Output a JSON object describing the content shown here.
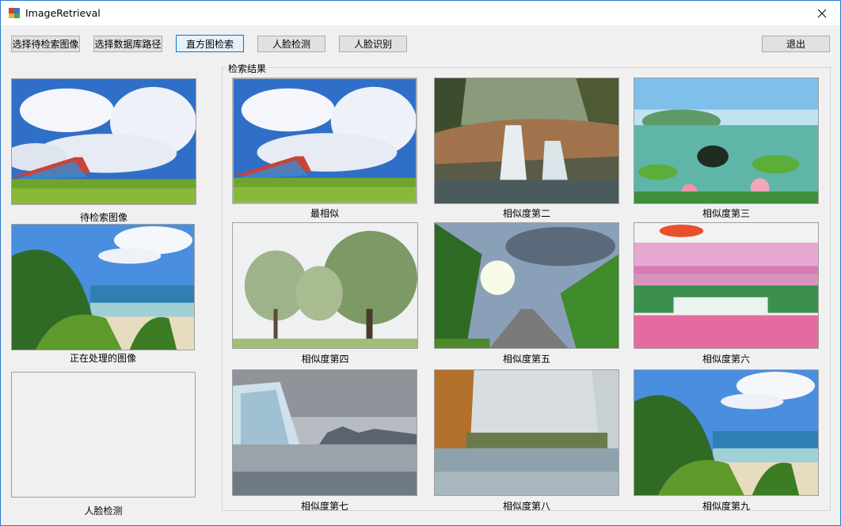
{
  "window": {
    "title": "ImageRetrieval"
  },
  "toolbar": {
    "select_query": "选择待检索图像",
    "select_db": "选择数据库路径",
    "hist_search": "直方图检索",
    "face_detect": "人脸检测",
    "face_recog": "人脸识别",
    "exit": "退出"
  },
  "left": {
    "query_caption": "待检索图像",
    "processing_caption": "正在处理的图像",
    "face_caption": "人脸检测"
  },
  "results": {
    "group_title": "检索结果",
    "items": [
      {
        "caption": "最相似"
      },
      {
        "caption": "相似度第二"
      },
      {
        "caption": "相似度第三"
      },
      {
        "caption": "相似度第四"
      },
      {
        "caption": "相似度第五"
      },
      {
        "caption": "相似度第六"
      },
      {
        "caption": "相似度第七"
      },
      {
        "caption": "相似度第八"
      },
      {
        "caption": "相似度第九"
      }
    ]
  }
}
